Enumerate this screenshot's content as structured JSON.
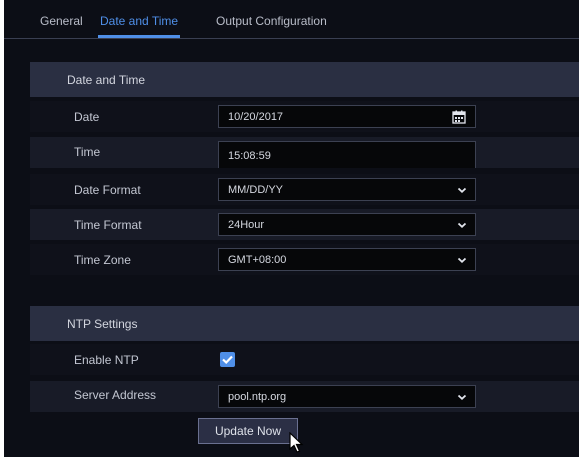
{
  "tabs": [
    {
      "label": "General",
      "active": false
    },
    {
      "label": "Date and Time",
      "active": true
    },
    {
      "label": "Output Configuration",
      "active": false
    }
  ],
  "date_time_section": {
    "title": "Date and Time",
    "date": {
      "label": "Date",
      "value": "10/20/2017",
      "icon": "calendar-icon"
    },
    "time": {
      "label": "Time",
      "value": "15:08:59"
    },
    "date_format": {
      "label": "Date Format",
      "value": "MM/DD/YY"
    },
    "time_format": {
      "label": "Time Format",
      "value": "24Hour"
    },
    "time_zone": {
      "label": "Time Zone",
      "value": "GMT+08:00"
    }
  },
  "ntp_section": {
    "title": "NTP Settings",
    "enable_ntp": {
      "label": "Enable NTP",
      "checked": true
    },
    "server_address": {
      "label": "Server Address",
      "value": "pool.ntp.org"
    },
    "update_button": "Update Now"
  },
  "colors": {
    "accent": "#4f8fe8",
    "background": "#0c0e16",
    "section_header": "#2a2f42"
  }
}
